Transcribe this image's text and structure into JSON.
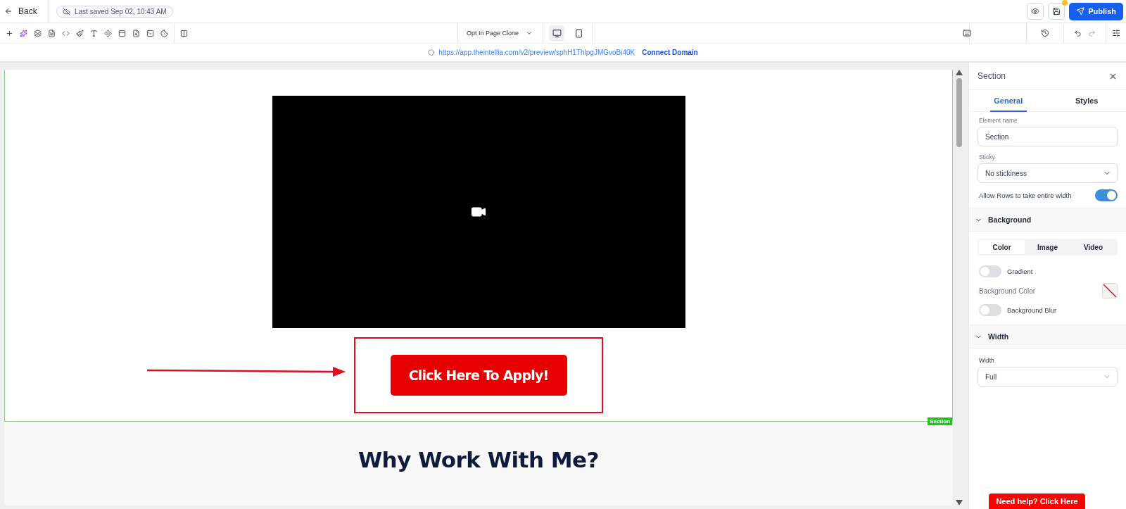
{
  "top_bar": {
    "back": "Back",
    "save_status": "Last saved Sep 02, 10:43 AM",
    "unsaved_changes": true,
    "publish": "Publish"
  },
  "toolbar": {
    "page_select": "Opt In Page Clone",
    "devices": [
      {
        "kind": "desktop",
        "selected": true
      },
      {
        "kind": "mobile",
        "selected": false
      }
    ]
  },
  "url_bar": {
    "url": "https://app.theintellia.com/v2/preview/sphH1ThlpgJMGvoBi40K",
    "link": "Connect Domain"
  },
  "canvas": {
    "cta_button": "Click Here To Apply!",
    "section_badge": "Section",
    "heading": "Why Work With Me?"
  },
  "panel": {
    "title": "Section",
    "tabs": [
      {
        "label": "General",
        "selected": true
      },
      {
        "label": "Styles",
        "selected": false
      }
    ],
    "element_name": {
      "label": "Element name",
      "value": "Section"
    },
    "sticky": {
      "label": "Sticky",
      "value": "No stickiness"
    },
    "allow_rows": {
      "label": "Allow Rows to take entire width",
      "on": true
    },
    "background": {
      "title": "Background",
      "expanded": true,
      "modes": [
        {
          "label": "Color",
          "selected": true
        },
        {
          "label": "Image",
          "selected": false
        },
        {
          "label": "Video",
          "selected": false
        }
      ],
      "gradient": {
        "label": "Gradient",
        "on": false
      },
      "color_label": "Background Color",
      "blur": {
        "label": "Background Blur",
        "on": false
      }
    },
    "width": {
      "title": "Width",
      "expanded": true,
      "label": "Width",
      "value": "Full"
    }
  },
  "help_button": "Need help? Click Here"
}
